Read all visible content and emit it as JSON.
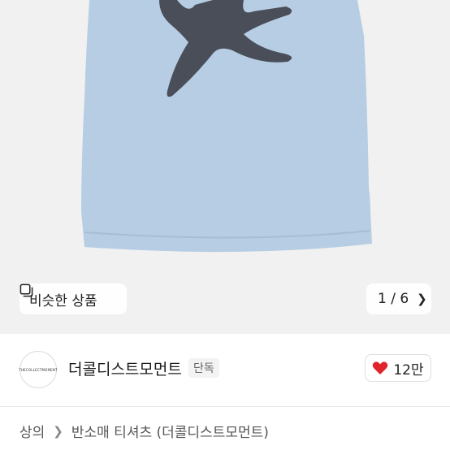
{
  "gallery": {
    "similar_label": "비슷한 상품",
    "counter": "1 / 6",
    "background": "#f1f1f1",
    "shirt_color": "#b7cde4",
    "print_color": "#4a4e58"
  },
  "seller": {
    "avatar_text": "THECOLLECTMOMENT",
    "name": "더콜디스트모먼트",
    "badge": "단독",
    "likes": "12만",
    "heart_color": "#e0242b"
  },
  "breadcrumb": {
    "category": "상의",
    "subcategory": "반소매 티셔츠 (더콜디스트모먼트)"
  }
}
